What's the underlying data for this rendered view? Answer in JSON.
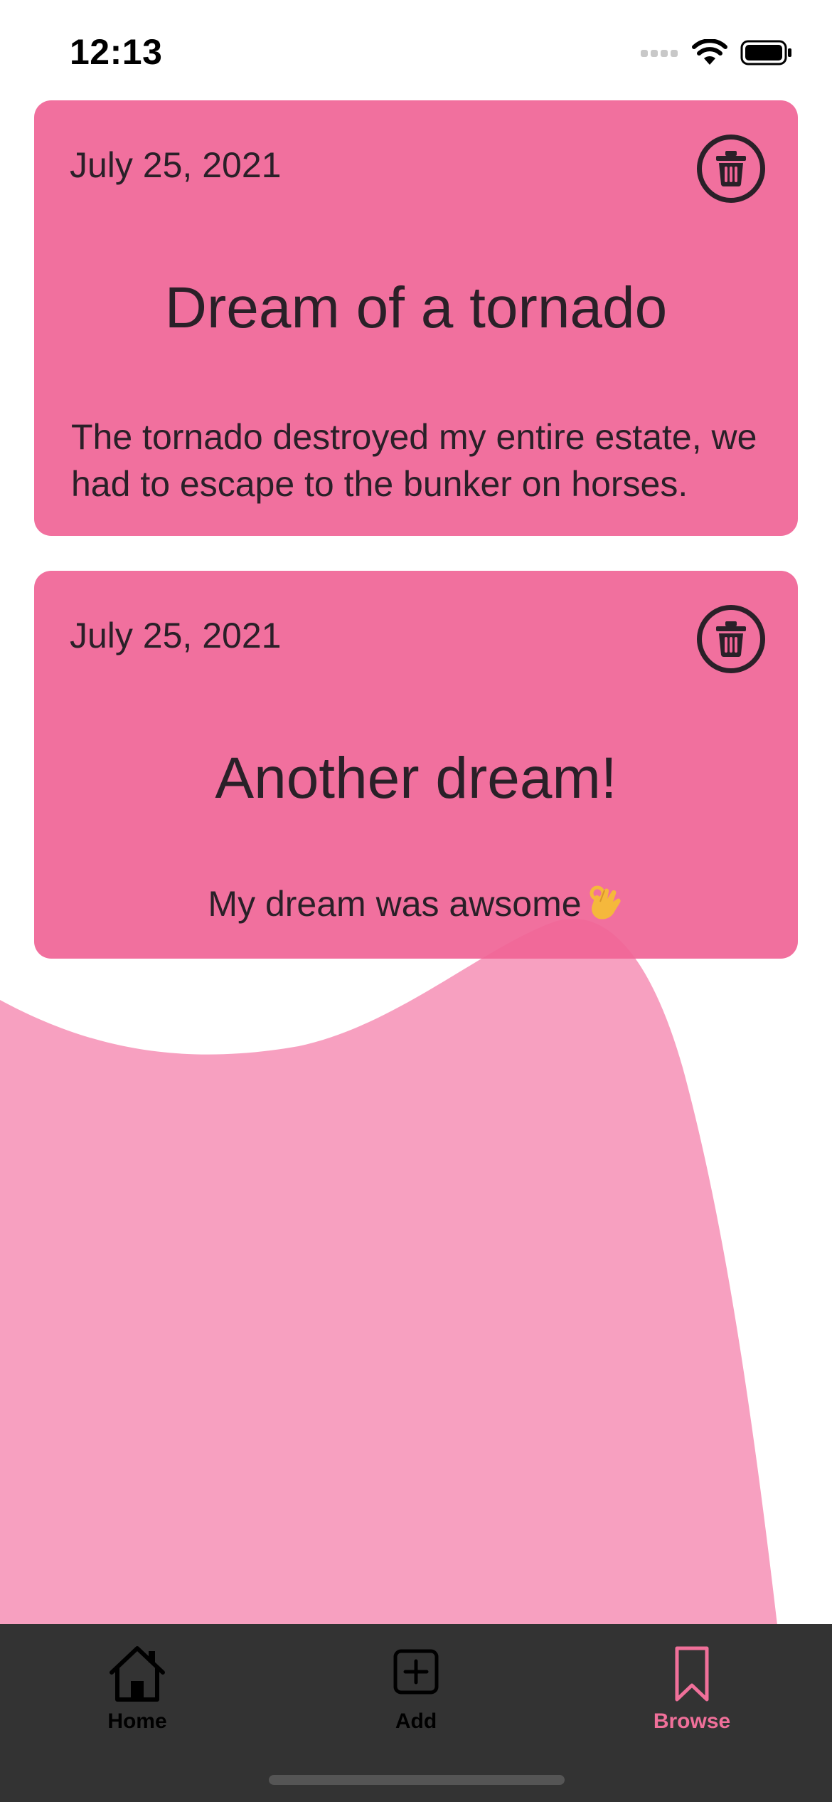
{
  "status_bar": {
    "time": "12:13",
    "icons": [
      "signal-icon",
      "wifi-icon",
      "battery-icon"
    ]
  },
  "dreams": [
    {
      "date": "July 25, 2021",
      "title": "Dream of a tornado",
      "body": "The tornado destroyed my entire estate, we had to escape to the bunker on horses.",
      "delete_icon": "trash-icon"
    },
    {
      "date": "July 25, 2021",
      "title": "Another dream!",
      "body": "My dream was awsome",
      "body_emoji": "ok-hand-emoji",
      "delete_icon": "trash-icon"
    }
  ],
  "tab_bar": {
    "items": [
      {
        "label": "Home",
        "icon": "home-icon",
        "active": false
      },
      {
        "label": "Add",
        "icon": "plus-square-icon",
        "active": false
      },
      {
        "label": "Browse",
        "icon": "bookmark-icon",
        "active": true
      }
    ],
    "active_color": "#f0709a",
    "background_color": "#333333"
  },
  "colors": {
    "card": "#f06496",
    "wave": "#f7a0c0",
    "text": "#2a2028"
  }
}
